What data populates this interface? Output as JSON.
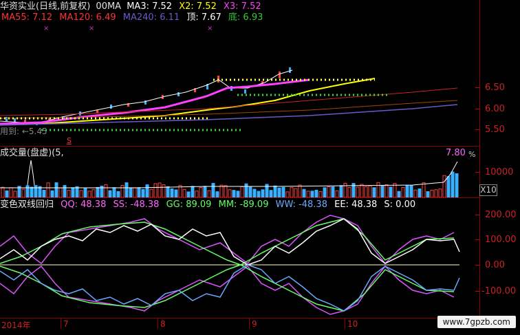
{
  "header": {
    "title": "华资实业(日线,前复权)",
    "ma_group": "00MA",
    "ma3": "MA3: 7.52",
    "x2": "X2: 7.52",
    "x3": "X3: 7.52",
    "ma55": "MA55: 7.12",
    "ma120": "MA120: 6.49",
    "ma240": "MA240: 6.11",
    "top": "顶: 7.67",
    "bottom": "底: 6.93",
    "colors": {
      "ma3": "#ffffff",
      "x2": "#ffff00",
      "x3": "#ff40ff",
      "ma55": "#ff3333",
      "ma120": "#ff3333",
      "ma240": "#6a5acd",
      "top": "#ffffff",
      "bottom": "#33cc33"
    }
  },
  "price_panel": {
    "axis_labels": [
      "6.50",
      "6.00",
      "5.50"
    ],
    "low_label": "用到: ←5.45",
    "s_marker": "S"
  },
  "volume_panel": {
    "title": "成交量(盘虚)(5,",
    "peak_label": "7.80",
    "right_char": "%",
    "axis_labels": [
      "10000"
    ],
    "unit_label": "X10"
  },
  "indicator_panel": {
    "title": "变色双线回归",
    "qq": "QQ: 48.38",
    "ss": "SS: -48.38",
    "gg": "GG: 89.09",
    "mm": "MM: -89.09",
    "ww": "WW: -48.38",
    "ee": "EE: 48.38",
    "s": "S: 0.00",
    "axis_labels": [
      "200.00",
      "100.00",
      "0.00",
      "-100.00"
    ],
    "colors": {
      "title": "#e8e8e8",
      "qq": "#ff66ff",
      "ss": "#ff66ff",
      "gg": "#66ff66",
      "mm": "#66ff66",
      "ww": "#6aaaff",
      "ee": "#ffffff",
      "s": "#ffffff"
    }
  },
  "date_axis": [
    "2014年",
    "7",
    "8",
    "9",
    "10"
  ],
  "watermark": "www.7gpzb.com"
}
